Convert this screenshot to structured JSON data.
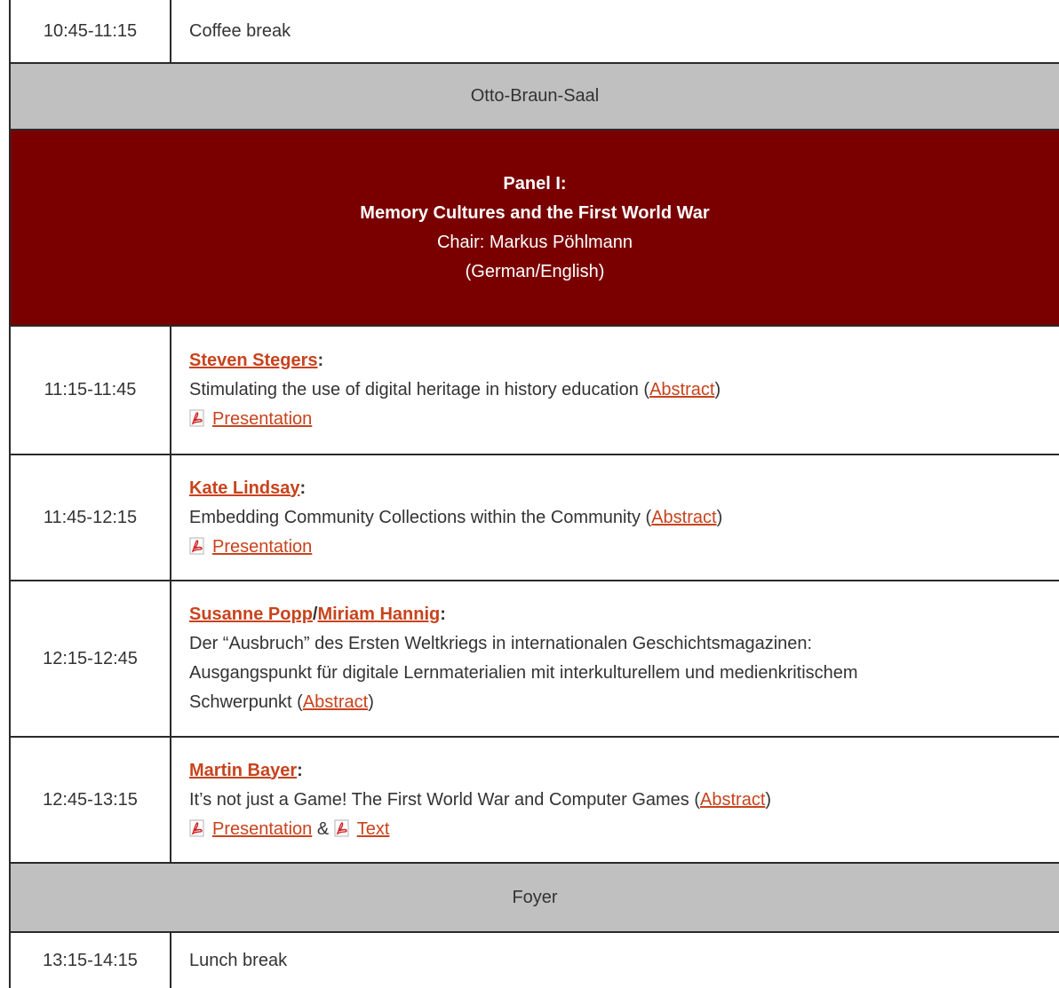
{
  "rows": {
    "coffee": {
      "time": "10:45-11:15",
      "text": "Coffee break"
    },
    "venue1": {
      "label": "Otto-Braun-Saal"
    },
    "panel": {
      "line1": "Panel I:",
      "line2": "Memory Cultures and the First World War",
      "line3": "Chair: Markus Pöhlmann",
      "line4": "(German/English)"
    },
    "talk1": {
      "time": "11:15-11:45",
      "author": "Steven Stegers",
      "title": "Stimulating the use of digital heritage in history education",
      "abstract": "Abstract",
      "presentation": "Presentation"
    },
    "talk2": {
      "time": "11:45-12:15",
      "author": "Kate Lindsay",
      "title": "Embedding Community Collections within the Community",
      "abstract": "Abstract",
      "presentation": "Presentation"
    },
    "talk3": {
      "time": "12:15-12:45",
      "author1": "Susanne Popp",
      "author2": "Miriam Hannig",
      "title_line1": "Der “Ausbruch” des Ersten Weltkriegs in internationalen Geschichtsmagazinen:",
      "title_line2": "Ausgangspunkt für digitale Lernmaterialien mit interkulturellem und medienkritischem",
      "title_line3": "Schwerpunkt",
      "abstract": "Abstract"
    },
    "talk4": {
      "time": "12:45-13:15",
      "author": "Martin Bayer",
      "title": "It’s not just a Game! The First World War and Computer Games",
      "abstract": "Abstract",
      "presentation": "Presentation",
      "text_link": "Text"
    },
    "venue2": {
      "label": "Foyer"
    },
    "lunch": {
      "time": "13:15-14:15",
      "text": "Lunch break"
    }
  },
  "colors": {
    "panel_bg": "#7a0000",
    "venue_bg": "#c0c0c0",
    "link": "#c8431d"
  },
  "icons": {
    "pdf": "pdf-icon"
  }
}
